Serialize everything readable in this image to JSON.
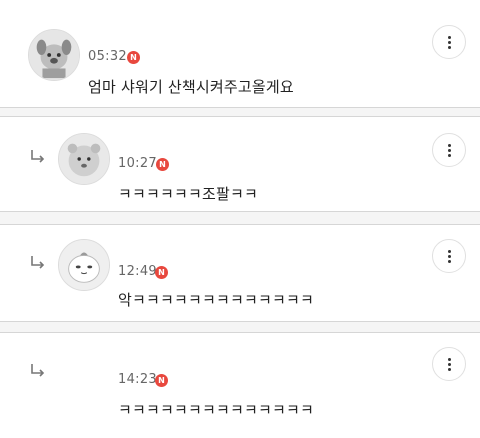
{
  "comments": [
    {
      "time": "05:32",
      "badge": "N",
      "text": "엄마 샤워기 산책시켜주고올게요",
      "is_reply": false,
      "avatar": "dog-avatar"
    },
    {
      "time": "10:27",
      "badge": "N",
      "text": "ㅋㅋㅋㅋㅋㅋ조팔ㅋㅋ",
      "is_reply": true,
      "avatar": "bear-avatar"
    },
    {
      "time": "12:49",
      "badge": "N",
      "text": "악ㅋㅋㅋㅋㅋㅋㅋㅋㅋㅋㅋㅋㅋ",
      "is_reply": true,
      "avatar": "peach-avatar"
    },
    {
      "time": "14:23",
      "badge": "N",
      "text": "ㅋㅋㅋㅋㅋㅋㅋㅋㅋㅋㅋㅋㅋㅋ",
      "is_reply": true,
      "avatar": ""
    }
  ],
  "icons": {
    "reply": "reply-arrow-icon",
    "more": "more-vertical-icon",
    "new": "new-badge"
  },
  "colors": {
    "badge": "#e8483e",
    "time": "#666666",
    "text": "#222222"
  }
}
